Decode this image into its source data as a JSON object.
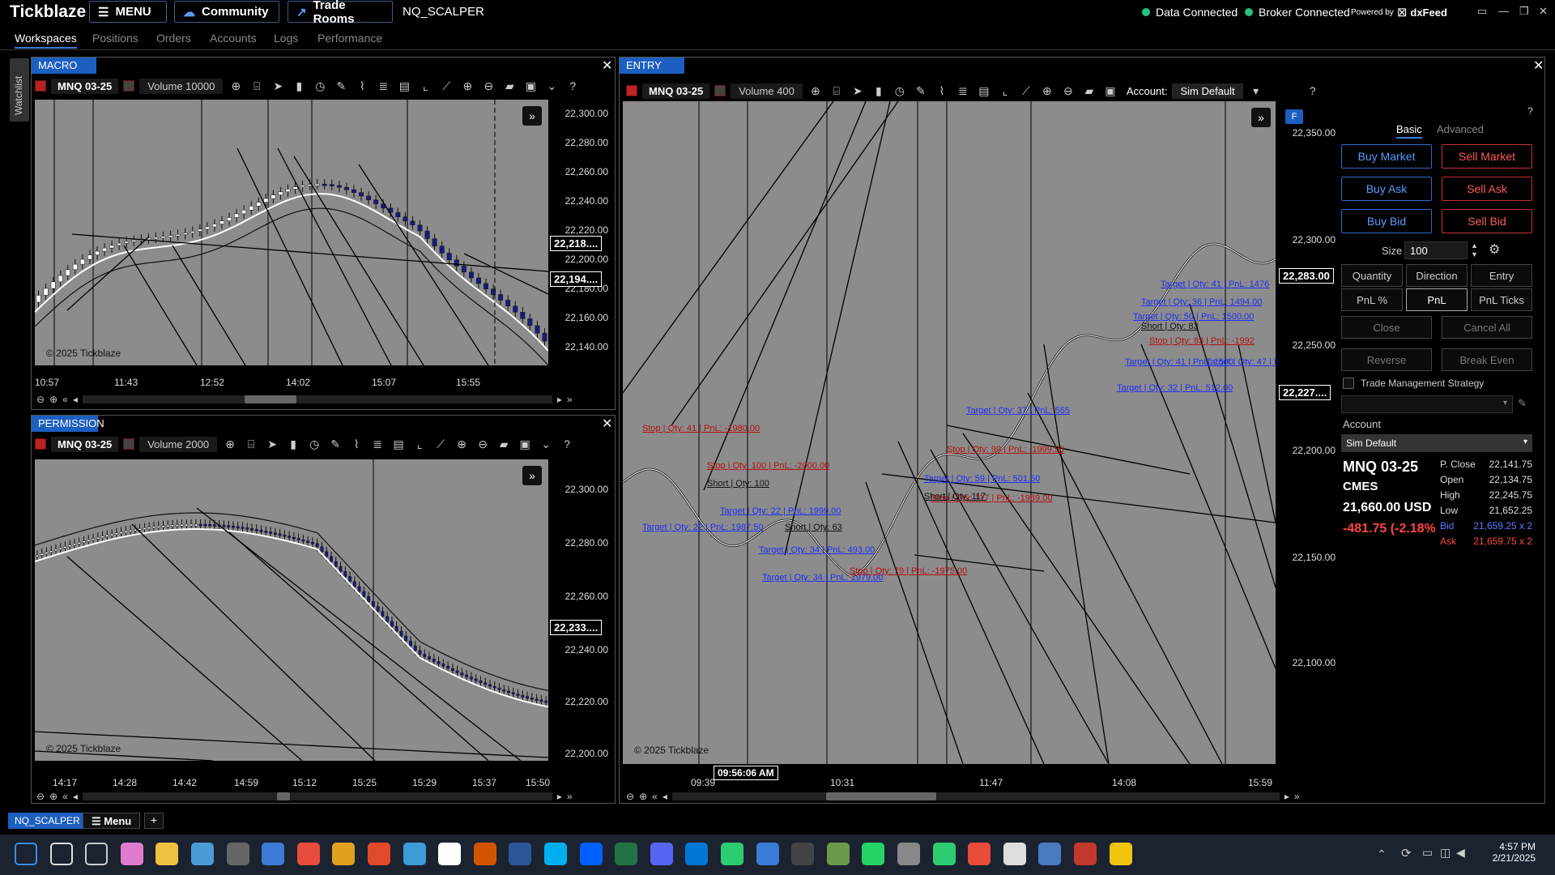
{
  "app": {
    "logo": "Tickblaze",
    "menu_label": "MENU",
    "community_label": "Community",
    "trade_rooms_label": "Trade Rooms",
    "workspace_name": "NQ_SCALPER",
    "data_status": "Data Connected",
    "broker_status": "Broker Connected",
    "powered_by": "Powered by",
    "feed_brand": "dxFeed"
  },
  "nav": {
    "tabs": [
      "Workspaces",
      "Positions",
      "Orders",
      "Accounts",
      "Logs",
      "Performance"
    ],
    "active": "Workspaces"
  },
  "watchlist_label": "Watchlist",
  "macro": {
    "title": "MACRO",
    "symbol": "MNQ 03-25",
    "volume": "Volume 10000",
    "y_ticks": [
      "22,300.00",
      "22,280.00",
      "22,260.00",
      "22,240.00",
      "22,220.00",
      "22,200.00",
      "22,180.00",
      "22,160.00",
      "22,140.00"
    ],
    "x_ticks": [
      "10:57",
      "11:43",
      "12:52",
      "14:02",
      "15:07",
      "15:55"
    ],
    "tag_upper": "22,218....",
    "tag_current": "22,194....",
    "copyright": "© 2025 Tickblaze"
  },
  "permission": {
    "title": "PERMISSION",
    "symbol": "MNQ 03-25",
    "volume": "Volume 2000",
    "y_ticks": [
      "22,300.00",
      "22,280.00",
      "22,260.00",
      "22,240.00",
      "22,220.00",
      "22,200.00"
    ],
    "x_ticks": [
      "14:17",
      "14:28",
      "14:42",
      "14:59",
      "15:12",
      "15:25",
      "15:29",
      "15:37",
      "15:50"
    ],
    "tag_current": "22,233....",
    "copyright": "© 2025 Tickblaze"
  },
  "entry": {
    "title": "ENTRY",
    "symbol": "MNQ 03-25",
    "volume": "Volume 400",
    "account_label": "Account:",
    "account_value": "Sim Default",
    "y_ticks": [
      "22,350.00",
      "22,300.00",
      "22,250.00",
      "22,200.00",
      "22,150.00",
      "22,100.00"
    ],
    "x_ticks": [
      "09:39",
      "10:31",
      "11:47",
      "14:08",
      "15:59"
    ],
    "cursor_time": "09:56:06 AM",
    "tag_upper": "22,283.00",
    "tag_current": "22,227....",
    "copyright": "© 2025 Tickblaze",
    "f_badge": "F",
    "orders": [
      {
        "text": "Target | Qty: 41 | PnL: 1476",
        "kind": "tgt"
      },
      {
        "text": "Target | Qty: 36 | PnL: 1494.00",
        "kind": "tgt"
      },
      {
        "text": "Target | Qty: 50 | PnL: 1500.00",
        "kind": "tgt"
      },
      {
        "text": "Short | Qty: 83",
        "kind": "neutral"
      },
      {
        "text": "Stop | Qty: 83 | PnL: -1992",
        "kind": "stp"
      },
      {
        "text": "Target | Qty: 47 | PnL: 8000.00",
        "kind": "tgt"
      },
      {
        "text": "Target | Qty: 41 | PnL: 1500",
        "kind": "tgt"
      },
      {
        "text": "Target | Qty: 32 | PnL: 512.00",
        "kind": "tgt"
      },
      {
        "text": "Target | Qty: 37 | PnL: 555",
        "kind": "tgt"
      },
      {
        "text": "Stop | Qty: 41 | PnL: -1980.00",
        "kind": "stp"
      },
      {
        "text": "Stop | Qty: 100 | PnL: -2000.00",
        "kind": "stp"
      },
      {
        "text": "Short | Qty: 100",
        "kind": "neutral"
      },
      {
        "text": "Target | Qty: 22 | PnL: 1987.50",
        "kind": "tgt"
      },
      {
        "text": "Target | Qty: 59 | PnL: 501.50",
        "kind": "tgt"
      },
      {
        "text": "Stop | Qty: 117 | PnL: -1989.00",
        "kind": "stp"
      },
      {
        "text": "Short | Qty: 117",
        "kind": "neutral"
      },
      {
        "text": "Target | Qty: 34 | PnL: 493.00",
        "kind": "tgt"
      },
      {
        "text": "Short | Qty: 63",
        "kind": "neutral"
      },
      {
        "text": "Target | Qty: 22 | PnL: 1999.00",
        "kind": "tgt"
      },
      {
        "text": "Target | Qty: 34 | PnL: 1979.00",
        "kind": "tgt"
      },
      {
        "text": "Stop | Qty: 79 | PnL: -1975.00",
        "kind": "stp"
      },
      {
        "text": "Stop | Qty: 99 | PnL: -1999.50",
        "kind": "stp"
      }
    ]
  },
  "order_panel": {
    "tab_basic": "Basic",
    "tab_advanced": "Advanced",
    "buy_market": "Buy Market",
    "sell_market": "Sell Market",
    "buy_ask": "Buy Ask",
    "sell_ask": "Sell Ask",
    "buy_bid": "Buy Bid",
    "sell_bid": "Sell Bid",
    "size_label": "Size",
    "size_value": "100",
    "quantity": "Quantity",
    "direction": "Direction",
    "entry": "Entry",
    "pnl_pct": "PnL %",
    "pnl": "PnL",
    "pnl_ticks": "PnL Ticks",
    "close": "Close",
    "cancel_all": "Cancel All",
    "reverse": "Reverse",
    "break_even": "Break Even",
    "tms_label": "Trade Management Strategy",
    "account_label": "Account",
    "account_value": "Sim Default",
    "symbol": "MNQ 03-25",
    "exchange": "CMES",
    "price": "21,660.00 USD",
    "change": "-481.75 (-2.18%",
    "stats": [
      {
        "label": "P. Close",
        "value": "22,141.75"
      },
      {
        "label": "Open",
        "value": "22,134.75"
      },
      {
        "label": "High",
        "value": "22,245.75"
      },
      {
        "label": "Low",
        "value": "21,652.25"
      },
      {
        "label": "Bid",
        "value": "21,659.25 x 2"
      },
      {
        "label": "Ask",
        "value": "21,659.75 x 2"
      }
    ]
  },
  "bottom": {
    "workspace_tab": "NQ_SCALPER",
    "menu_label": "Menu",
    "add_label": "+"
  },
  "taskbar": {
    "time": "4:57 PM",
    "date": "2/21/2025"
  },
  "colors": {
    "accent": "#1c5fc0",
    "chart_bg": "#8c8c8c",
    "target": "#1f2ff0",
    "stop": "#b31010",
    "connected": "#26c281"
  }
}
